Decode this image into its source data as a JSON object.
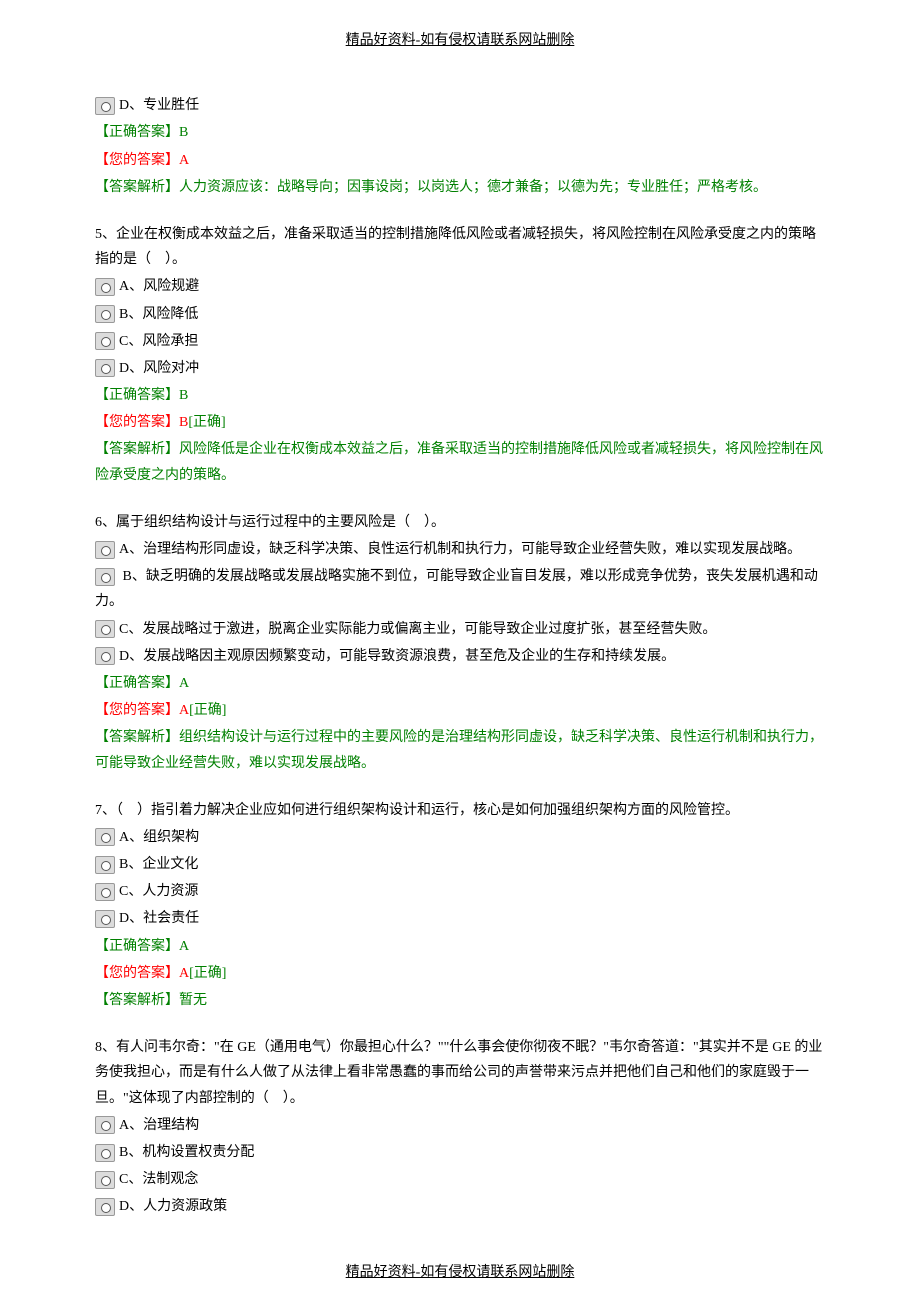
{
  "header": "精品好资料-如有侵权请联系网站删除",
  "footer": "精品好资料-如有侵权请联系网站删除",
  "labels": {
    "correct_answer": "【正确答案】",
    "your_answer": "【您的答案】",
    "explanation": "【答案解析】",
    "correct_mark": "[正确]"
  },
  "q4_tail": {
    "option_d": "D、专业胜任",
    "correct": "B",
    "your": "A",
    "explanation": "人力资源应该：战略导向；因事设岗；以岗选人；德才兼备；以德为先；专业胜任；严格考核。"
  },
  "q5": {
    "question": "5、企业在权衡成本效益之后，准备采取适当的控制措施降低风险或者减轻损失，将风险控制在风险承受度之内的策略指的是（　）。",
    "options": {
      "a": "A、风险规避",
      "b": "B、风险降低",
      "c": "C、风险承担",
      "d": "D、风险对冲"
    },
    "correct": "B",
    "your": "B",
    "explanation": "风险降低是企业在权衡成本效益之后，准备采取适当的控制措施降低风险或者减轻损失，将风险控制在风险承受度之内的策略。"
  },
  "q6": {
    "question": "6、属于组织结构设计与运行过程中的主要风险是（　）。",
    "options": {
      "a": "A、治理结构形同虚设，缺乏科学决策、良性运行机制和执行力，可能导致企业经营失败，难以实现发展战略。",
      "b": "B、缺乏明确的发展战略或发展战略实施不到位，可能导致企业盲目发展，难以形成竞争优势，丧失发展机遇和动力。",
      "c": "C、发展战略过于激进，脱离企业实际能力或偏离主业，可能导致企业过度扩张，甚至经营失败。",
      "d": "D、发展战略因主观原因频繁变动，可能导致资源浪费，甚至危及企业的生存和持续发展。"
    },
    "correct": "A",
    "your": "A",
    "explanation": "组织结构设计与运行过程中的主要风险的是治理结构形同虚设，缺乏科学决策、良性运行机制和执行力，可能导致企业经营失败，难以实现发展战略。"
  },
  "q7": {
    "question": "7、（　）指引着力解决企业应如何进行组织架构设计和运行，核心是如何加强组织架构方面的风险管控。",
    "options": {
      "a": "A、组织架构",
      "b": "B、企业文化",
      "c": "C、人力资源",
      "d": "D、社会责任"
    },
    "correct": "A",
    "your": "A",
    "explanation": "暂无"
  },
  "q8": {
    "question": "8、有人问韦尔奇：\"在 GE（通用电气）你最担心什么？\"\"什么事会使你彻夜不眠？\"韦尔奇答道：\"其实并不是 GE 的业务使我担心，而是有什么人做了从法律上看非常愚蠢的事而给公司的声誉带来污点并把他们自己和他们的家庭毁于一旦。\"这体现了内部控制的（　）。",
    "options": {
      "a": "A、治理结构",
      "b": "B、机构设置权责分配",
      "c": "C、法制观念",
      "d": "D、人力资源政策"
    }
  }
}
